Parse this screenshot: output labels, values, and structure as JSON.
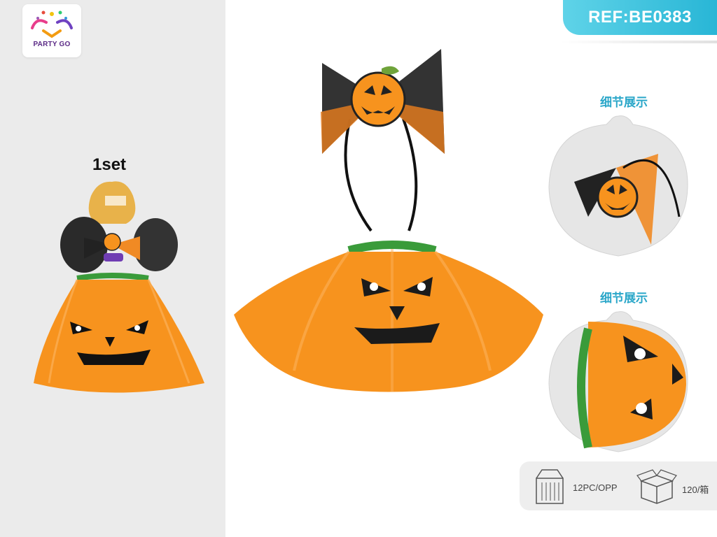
{
  "brand": {
    "logo_text": "PARTY GO"
  },
  "packaged": {
    "set_label": "1set"
  },
  "reference": {
    "label": "REF:BE0383"
  },
  "details": [
    {
      "title": "细节展示"
    },
    {
      "title": "细节展示"
    }
  ],
  "packing": {
    "inner": "12PC/OPP",
    "carton": "120/箱"
  },
  "colors": {
    "tutu_orange": "#f7931e",
    "felt_black": "#1b1b1b",
    "waistband_green": "#3a9b3a",
    "ref_badge": "#28b6d6",
    "detail_title": "#2ba7c9"
  },
  "icons": [
    "display-box-icon",
    "carton-box-icon"
  ]
}
